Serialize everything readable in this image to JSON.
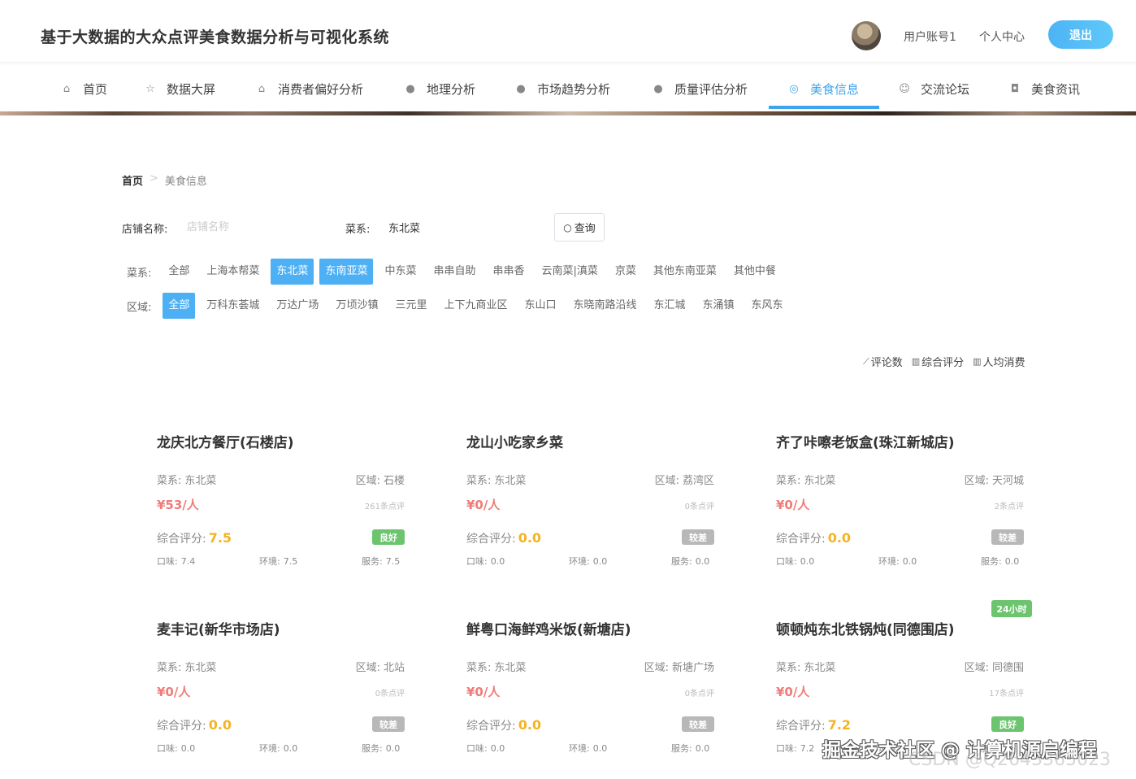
{
  "header": {
    "title": "基于大数据的大众点评美食数据分析与可视化系统",
    "user_name": "用户账号1",
    "user_center": "个人中心",
    "logout": "退出"
  },
  "nav": {
    "items": [
      {
        "label": "首页",
        "icon": "home-icon",
        "glyph": "⌂"
      },
      {
        "label": "数据大屏",
        "icon": "star-icon",
        "glyph": "☆"
      },
      {
        "label": "消费者偏好分析",
        "icon": "bag-icon",
        "glyph": "⌂"
      },
      {
        "label": "地理分析",
        "icon": "alert-circle-icon",
        "glyph": "●"
      },
      {
        "label": "市场趋势分析",
        "icon": "question-circle-icon",
        "glyph": "●"
      },
      {
        "label": "质量评估分析",
        "icon": "info-circle-icon",
        "glyph": "●"
      },
      {
        "label": "美食信息",
        "icon": "target-icon",
        "glyph": "◎"
      },
      {
        "label": "交流论坛",
        "icon": "smile-icon",
        "glyph": "☺"
      },
      {
        "label": "美食资讯",
        "icon": "camera-icon",
        "glyph": "◘"
      }
    ],
    "active_index": 6,
    "accent_color": "#3ea4ee"
  },
  "breadcrumb": {
    "home": "首页",
    "separator": ">",
    "current": "美食信息"
  },
  "search": {
    "shop_label": "店铺名称:",
    "shop_placeholder": "店铺名称",
    "shop_value": "",
    "cuisine_label": "菜系:",
    "cuisine_value": "东北菜",
    "query_button": "查询"
  },
  "filters": {
    "cuisine": {
      "label": "菜系:",
      "options": [
        "全部",
        "上海本帮菜",
        "东北菜",
        "东南亚菜",
        "中东菜",
        "串串自助",
        "串串香",
        "云南菜|滇菜",
        "京菜",
        "其他东南亚菜",
        "其他中餐"
      ],
      "selected": [
        "东北菜",
        "东南亚菜"
      ]
    },
    "area": {
      "label": "区域:",
      "options": [
        "全部",
        "万科东荟城",
        "万达广场",
        "万顷沙镇",
        "三元里",
        "上下九商业区",
        "东山口",
        "东晓南路沿线",
        "东汇城",
        "东涌镇",
        "东风东"
      ],
      "selected": [
        "全部"
      ]
    }
  },
  "sort": {
    "items": [
      {
        "label": "评论数",
        "icon": "trend-icon"
      },
      {
        "label": "综合评分",
        "icon": "bar-chart-icon"
      },
      {
        "label": "人均消费",
        "icon": "bar-chart-icon"
      }
    ]
  },
  "cards": [
    {
      "name": "龙庆北方餐厅(石楼店)",
      "cuisine_label": "菜系:",
      "cuisine": "东北菜",
      "area_label": "区域:",
      "area": "石楼",
      "price": "¥53/人",
      "reviews": "261条点评",
      "score_label": "综合评分:",
      "score": "7.5",
      "badge": "良好",
      "badge_color": "#6cc46e",
      "taste_label": "口味:",
      "taste": "7.4",
      "env_label": "环境:",
      "env": "7.5",
      "service_label": "服务:",
      "service": "7.5",
      "flag": ""
    },
    {
      "name": "龙山小吃家乡菜",
      "cuisine_label": "菜系:",
      "cuisine": "东北菜",
      "area_label": "区域:",
      "area": "荔湾区",
      "price": "¥0/人",
      "reviews": "0条点评",
      "score_label": "综合评分:",
      "score": "0.0",
      "badge": "较差",
      "badge_color": "#b8b8b8",
      "taste_label": "口味:",
      "taste": "0.0",
      "env_label": "环境:",
      "env": "0.0",
      "service_label": "服务:",
      "service": "0.0",
      "flag": ""
    },
    {
      "name": "齐了咔嚓老饭盒(珠江新城店)",
      "cuisine_label": "菜系:",
      "cuisine": "东北菜",
      "area_label": "区域:",
      "area": "天河城",
      "price": "¥0/人",
      "reviews": "2条点评",
      "score_label": "综合评分:",
      "score": "0.0",
      "badge": "较差",
      "badge_color": "#b8b8b8",
      "taste_label": "口味:",
      "taste": "0.0",
      "env_label": "环境:",
      "env": "0.0",
      "service_label": "服务:",
      "service": "0.0",
      "flag": ""
    },
    {
      "name": "麦丰记(新华市场店)",
      "cuisine_label": "菜系:",
      "cuisine": "东北菜",
      "area_label": "区域:",
      "area": "北站",
      "price": "¥0/人",
      "reviews": "0条点评",
      "score_label": "综合评分:",
      "score": "0.0",
      "badge": "较差",
      "badge_color": "#b8b8b8",
      "taste_label": "口味:",
      "taste": "0.0",
      "env_label": "环境:",
      "env": "0.0",
      "service_label": "服务:",
      "service": "0.0",
      "flag": ""
    },
    {
      "name": "鲜粤口海鲜鸡米饭(新塘店)",
      "cuisine_label": "菜系:",
      "cuisine": "东北菜",
      "area_label": "区域:",
      "area": "新塘广场",
      "price": "¥0/人",
      "reviews": "0条点评",
      "score_label": "综合评分:",
      "score": "0.0",
      "badge": "较差",
      "badge_color": "#b8b8b8",
      "taste_label": "口味:",
      "taste": "0.0",
      "env_label": "环境:",
      "env": "0.0",
      "service_label": "服务:",
      "service": "0.0",
      "flag": ""
    },
    {
      "name": "顿顿炖东北铁锅炖(同德围店)",
      "cuisine_label": "菜系:",
      "cuisine": "东北菜",
      "area_label": "区域:",
      "area": "同德围",
      "price": "¥0/人",
      "reviews": "17条点评",
      "score_label": "综合评分:",
      "score": "7.2",
      "badge": "良好",
      "badge_color": "#6cc46e",
      "taste_label": "口味:",
      "taste": "7.2",
      "env_label": "环境:",
      "env": "",
      "service_label": "服务:",
      "service": "",
      "flag": "24小时"
    }
  ],
  "watermark": {
    "line1": "掘金技术社区 @ 计算机源启编程",
    "line2": "CSDN @Q2643365023"
  },
  "colors": {
    "price": "#ef7c78",
    "score": "#f5b324",
    "chip_selected": "#4db0f4"
  }
}
